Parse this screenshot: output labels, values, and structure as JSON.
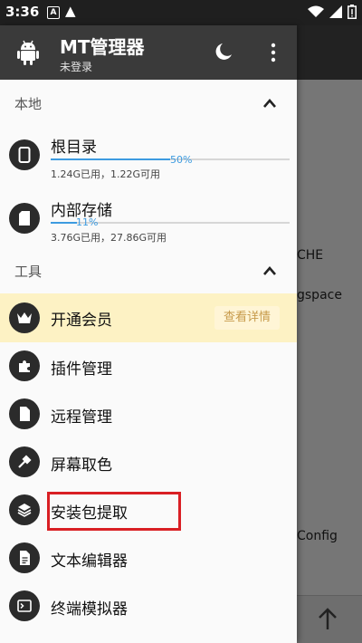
{
  "status_bar": {
    "time": "3:36",
    "badge_letter": "A",
    "warning_glyph": "▲",
    "icons": [
      "wifi-icon",
      "signal-icon",
      "battery-icon"
    ]
  },
  "background_app": {
    "text_1": "CHE",
    "text_2": "gspace",
    "text_3": "Config"
  },
  "header": {
    "title": "MT管理器",
    "subtitle": "未登录"
  },
  "sections": {
    "local": {
      "label": "本地"
    },
    "tools": {
      "label": "工具"
    }
  },
  "storage": [
    {
      "label": "根目录",
      "percent": "50%",
      "usage": "1.24G已用，1.22G可用",
      "fill": 0.5
    },
    {
      "label": "内部存储",
      "percent": "11%",
      "usage": "3.76G已用，27.86G可用",
      "fill": 0.11
    }
  ],
  "vip": {
    "label": "开通会员",
    "button": "查看详情"
  },
  "tools": [
    {
      "label": "插件管理",
      "icon": "puzzle-icon"
    },
    {
      "label": "远程管理",
      "icon": "document-icon"
    },
    {
      "label": "屏幕取色",
      "icon": "eyedropper-icon"
    },
    {
      "label": "安装包提取",
      "icon": "layers-icon"
    },
    {
      "label": "文本编辑器",
      "icon": "text-file-icon"
    },
    {
      "label": "终端模拟器",
      "icon": "terminal-icon"
    }
  ],
  "colors": {
    "accent": "#3d9be0",
    "vip_background": "#fdf2c4",
    "vip_button_text": "#c79a4a",
    "highlight": "#d91f24"
  }
}
